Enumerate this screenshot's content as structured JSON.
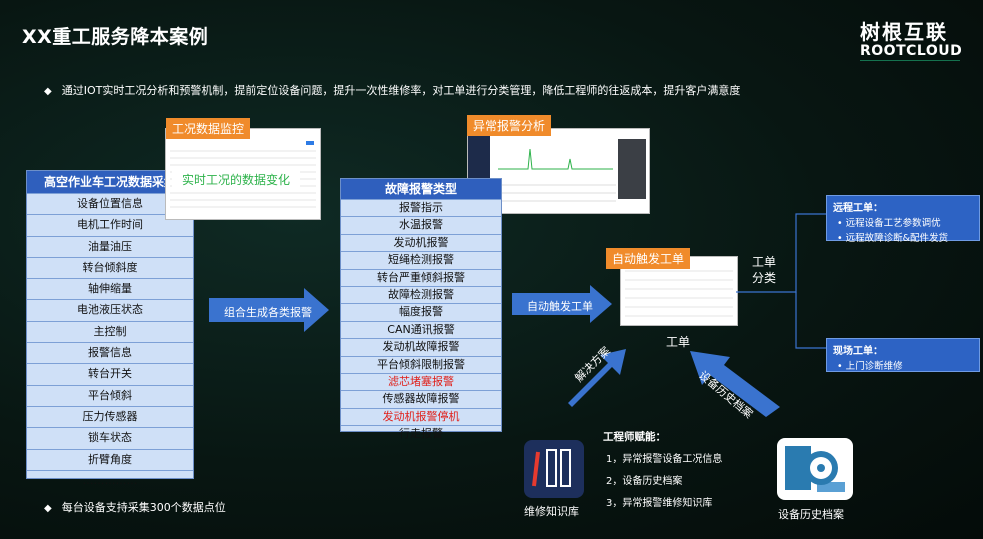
{
  "header": {
    "title": "XX重工服务降本案例",
    "logo_cn": "树根互联",
    "logo_en": "ROOTCLOUD"
  },
  "intro_bullet": "通过IOT实时工况分析和预警机制，提前定位设备问题，提升一次性维修率，对工单进行分类管理，降低工程师的往返成本，提升客户满意度",
  "footer_bullet": "每台设备支持采集300个数据点位",
  "monitor_tag": "工况数据监控",
  "monitor_overlay": "实时工况的数据变化",
  "alarm_tag": "异常报警分析",
  "left_list": {
    "title": "高空作业车工况数据采集",
    "items": [
      "设备位置信息",
      "电机工作时间",
      "油量油压",
      "转台倾斜度",
      "轴伸缩量",
      "电池液压状态",
      "主控制",
      "报警信息",
      "转台开关",
      "平台倾斜",
      "压力传感器",
      "锁车状态",
      "折臂角度",
      "……………"
    ]
  },
  "arrow_combine": "组合生成各类报警",
  "mid_list": {
    "title": "故障报警类型",
    "items": [
      {
        "label": "报警指示",
        "red": false
      },
      {
        "label": "水温报警",
        "red": false
      },
      {
        "label": "发动机报警",
        "red": false
      },
      {
        "label": "短绳检测报警",
        "red": false
      },
      {
        "label": "转台严重倾斜报警",
        "red": false
      },
      {
        "label": "故障检测报警",
        "red": false
      },
      {
        "label": "幅度报警",
        "red": false
      },
      {
        "label": "CAN通讯报警",
        "red": false
      },
      {
        "label": "发动机故障报警",
        "red": false
      },
      {
        "label": "平台倾斜限制报警",
        "red": false
      },
      {
        "label": "滤芯堵塞报警",
        "red": true
      },
      {
        "label": "传感器故障报警",
        "red": false
      },
      {
        "label": "发动机报警停机",
        "red": true
      },
      {
        "label": "行走报警",
        "red": false
      }
    ]
  },
  "arrow_auto": "自动触发工单",
  "auto_tag": "自动触发工单",
  "workorder_label": "工单",
  "classify_label": "工单\n分类",
  "remote": {
    "title": "远程工单：",
    "items": [
      "远程设备工艺参数调优",
      "远程故障诊断&配件发货"
    ]
  },
  "onsite": {
    "title": "现场工单：",
    "items": [
      "上门诊断维修"
    ]
  },
  "arrow_solution": "解决方案",
  "arrow_history": "设备历史档案",
  "engineer": {
    "title": "工程师赋能：",
    "items": [
      "1，异常报警设备工况信息",
      "2，设备历史档案",
      "3，异常报警维修知识库"
    ]
  },
  "kb_label": "维修知识库",
  "history_label": "设备历史档案",
  "icons": {
    "kb": "book-shelf-icon",
    "history": "truck-wheel-icon"
  },
  "colors": {
    "accent_blue": "#2f5fbd",
    "orange": "#f08b2b",
    "alarm_red": "#e0201a",
    "brand_green": "#1fb37a"
  }
}
